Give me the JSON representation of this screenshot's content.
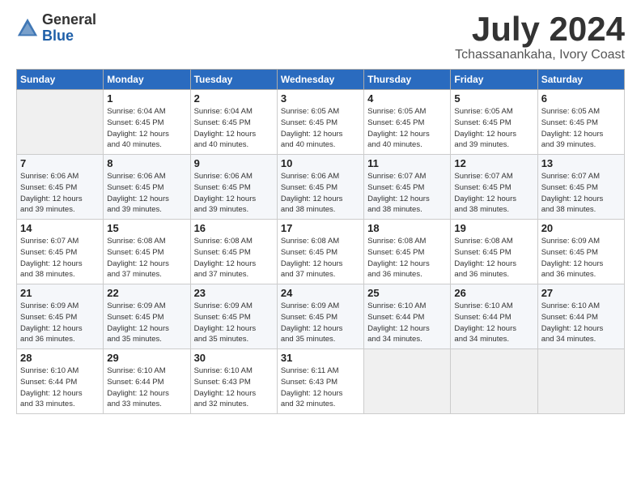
{
  "header": {
    "logo_general": "General",
    "logo_blue": "Blue",
    "month_title": "July 2024",
    "location": "Tchassanankaha, Ivory Coast"
  },
  "days_of_week": [
    "Sunday",
    "Monday",
    "Tuesday",
    "Wednesday",
    "Thursday",
    "Friday",
    "Saturday"
  ],
  "weeks": [
    [
      {
        "day": "",
        "empty": true
      },
      {
        "day": "1",
        "sunrise": "6:04 AM",
        "sunset": "6:45 PM",
        "daylight": "12 hours and 40 minutes."
      },
      {
        "day": "2",
        "sunrise": "6:04 AM",
        "sunset": "6:45 PM",
        "daylight": "12 hours and 40 minutes."
      },
      {
        "day": "3",
        "sunrise": "6:05 AM",
        "sunset": "6:45 PM",
        "daylight": "12 hours and 40 minutes."
      },
      {
        "day": "4",
        "sunrise": "6:05 AM",
        "sunset": "6:45 PM",
        "daylight": "12 hours and 40 minutes."
      },
      {
        "day": "5",
        "sunrise": "6:05 AM",
        "sunset": "6:45 PM",
        "daylight": "12 hours and 39 minutes."
      },
      {
        "day": "6",
        "sunrise": "6:05 AM",
        "sunset": "6:45 PM",
        "daylight": "12 hours and 39 minutes."
      }
    ],
    [
      {
        "day": "7",
        "sunrise": "6:06 AM",
        "sunset": "6:45 PM",
        "daylight": "12 hours and 39 minutes."
      },
      {
        "day": "8",
        "sunrise": "6:06 AM",
        "sunset": "6:45 PM",
        "daylight": "12 hours and 39 minutes."
      },
      {
        "day": "9",
        "sunrise": "6:06 AM",
        "sunset": "6:45 PM",
        "daylight": "12 hours and 39 minutes."
      },
      {
        "day": "10",
        "sunrise": "6:06 AM",
        "sunset": "6:45 PM",
        "daylight": "12 hours and 38 minutes."
      },
      {
        "day": "11",
        "sunrise": "6:07 AM",
        "sunset": "6:45 PM",
        "daylight": "12 hours and 38 minutes."
      },
      {
        "day": "12",
        "sunrise": "6:07 AM",
        "sunset": "6:45 PM",
        "daylight": "12 hours and 38 minutes."
      },
      {
        "day": "13",
        "sunrise": "6:07 AM",
        "sunset": "6:45 PM",
        "daylight": "12 hours and 38 minutes."
      }
    ],
    [
      {
        "day": "14",
        "sunrise": "6:07 AM",
        "sunset": "6:45 PM",
        "daylight": "12 hours and 38 minutes."
      },
      {
        "day": "15",
        "sunrise": "6:08 AM",
        "sunset": "6:45 PM",
        "daylight": "12 hours and 37 minutes."
      },
      {
        "day": "16",
        "sunrise": "6:08 AM",
        "sunset": "6:45 PM",
        "daylight": "12 hours and 37 minutes."
      },
      {
        "day": "17",
        "sunrise": "6:08 AM",
        "sunset": "6:45 PM",
        "daylight": "12 hours and 37 minutes."
      },
      {
        "day": "18",
        "sunrise": "6:08 AM",
        "sunset": "6:45 PM",
        "daylight": "12 hours and 36 minutes."
      },
      {
        "day": "19",
        "sunrise": "6:08 AM",
        "sunset": "6:45 PM",
        "daylight": "12 hours and 36 minutes."
      },
      {
        "day": "20",
        "sunrise": "6:09 AM",
        "sunset": "6:45 PM",
        "daylight": "12 hours and 36 minutes."
      }
    ],
    [
      {
        "day": "21",
        "sunrise": "6:09 AM",
        "sunset": "6:45 PM",
        "daylight": "12 hours and 36 minutes."
      },
      {
        "day": "22",
        "sunrise": "6:09 AM",
        "sunset": "6:45 PM",
        "daylight": "12 hours and 35 minutes."
      },
      {
        "day": "23",
        "sunrise": "6:09 AM",
        "sunset": "6:45 PM",
        "daylight": "12 hours and 35 minutes."
      },
      {
        "day": "24",
        "sunrise": "6:09 AM",
        "sunset": "6:45 PM",
        "daylight": "12 hours and 35 minutes."
      },
      {
        "day": "25",
        "sunrise": "6:10 AM",
        "sunset": "6:44 PM",
        "daylight": "12 hours and 34 minutes."
      },
      {
        "day": "26",
        "sunrise": "6:10 AM",
        "sunset": "6:44 PM",
        "daylight": "12 hours and 34 minutes."
      },
      {
        "day": "27",
        "sunrise": "6:10 AM",
        "sunset": "6:44 PM",
        "daylight": "12 hours and 34 minutes."
      }
    ],
    [
      {
        "day": "28",
        "sunrise": "6:10 AM",
        "sunset": "6:44 PM",
        "daylight": "12 hours and 33 minutes."
      },
      {
        "day": "29",
        "sunrise": "6:10 AM",
        "sunset": "6:44 PM",
        "daylight": "12 hours and 33 minutes."
      },
      {
        "day": "30",
        "sunrise": "6:10 AM",
        "sunset": "6:43 PM",
        "daylight": "12 hours and 32 minutes."
      },
      {
        "day": "31",
        "sunrise": "6:11 AM",
        "sunset": "6:43 PM",
        "daylight": "12 hours and 32 minutes."
      },
      {
        "day": "",
        "empty": true
      },
      {
        "day": "",
        "empty": true
      },
      {
        "day": "",
        "empty": true
      }
    ]
  ]
}
